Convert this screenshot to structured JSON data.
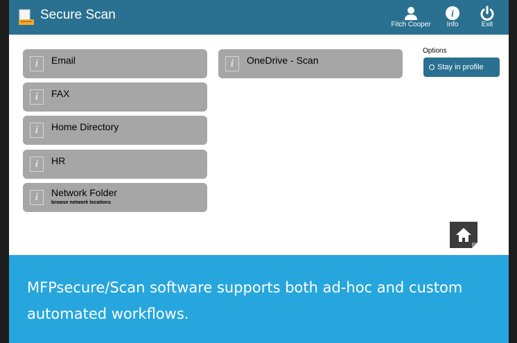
{
  "header": {
    "app_title": "Secure Scan",
    "user_name": "Fitch Cooper",
    "info_label": "Info",
    "exit_label": "Exit",
    "bg_color": "#2a7090"
  },
  "tiles": [
    {
      "label": "Email",
      "sub": "",
      "info": "i"
    },
    {
      "label": "FAX",
      "sub": "",
      "info": "i"
    },
    {
      "label": "Home Directory",
      "sub": "",
      "info": "i"
    },
    {
      "label": "HR",
      "sub": "",
      "info": "i"
    },
    {
      "label": "Network Folder",
      "sub": "browse network locations",
      "info": "i"
    },
    {
      "label": "OneDrive - Scan",
      "sub": "",
      "info": "i"
    }
  ],
  "options": {
    "label": "Options",
    "stay_in_profile": "Stay in profile"
  },
  "banner": {
    "text": "MFPsecure/Scan software supports both ad-hoc and custom automated workflows.",
    "bg_color": "#27a6de"
  },
  "icons": {
    "app": "scanner-icon",
    "user": "user-icon",
    "info": "info-icon",
    "exit": "power-icon",
    "home": "home-icon"
  }
}
